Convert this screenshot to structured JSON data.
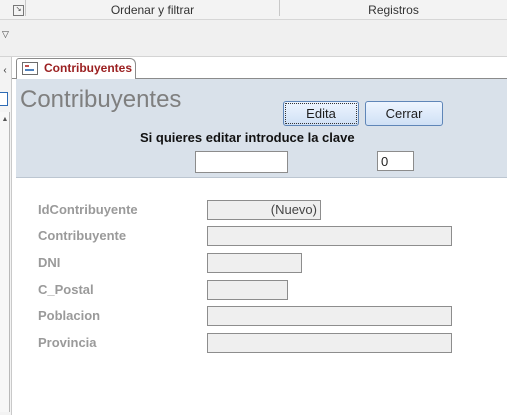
{
  "ribbon": {
    "group_sort_filter": "Ordenar y filtrar",
    "group_records": "Registros",
    "launcher_icon": "dialog-launcher-icon",
    "qat_icon": "chevron-down-icon"
  },
  "nav_pane": {
    "shutter_icon": "chevron-left-icon"
  },
  "document_tab": {
    "label": "Contribuyentes",
    "icon": "form-icon"
  },
  "form_header": {
    "title": "Contribuyentes",
    "edit_button_label": "Edita",
    "close_button_label": "Cerrar",
    "prompt": "Si quieres editar introduce la clave",
    "password_value": "",
    "counter_value": "0"
  },
  "detail": {
    "fields": [
      {
        "label": "IdContribuyente",
        "value": "(Nuevo)"
      },
      {
        "label": "Contribuyente",
        "value": ""
      },
      {
        "label": "DNI",
        "value": ""
      },
      {
        "label": "C_Postal",
        "value": ""
      },
      {
        "label": "Poblacion",
        "value": ""
      },
      {
        "label": "Provincia",
        "value": ""
      }
    ]
  },
  "colors": {
    "header_bg": "#d9e1ea",
    "tab_label": "#9b2021",
    "label_gray": "#9a9a9a",
    "button_border": "#5f86b8"
  }
}
